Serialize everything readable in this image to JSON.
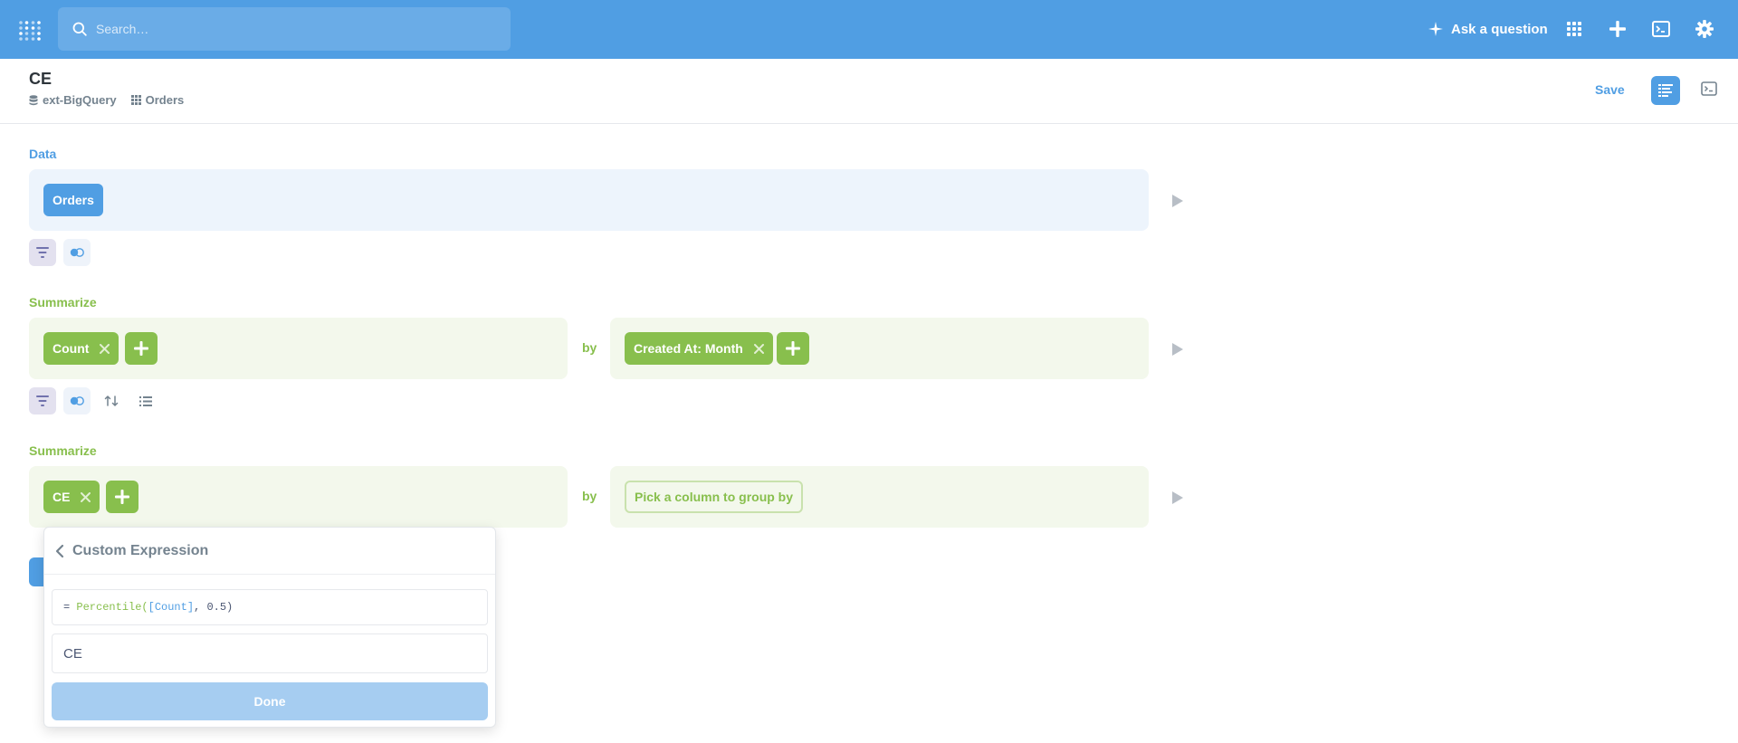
{
  "topbar": {
    "search_placeholder": "Search…",
    "ask_label": "Ask a question",
    "icons": [
      "metabase-logo-icon",
      "search-icon",
      "sparkle-icon",
      "grid-icon",
      "plus-icon",
      "sql-editor-icon",
      "gear-icon"
    ]
  },
  "header": {
    "title": "CE",
    "database": "ext-BigQuery",
    "table": "Orders",
    "save_label": "Save"
  },
  "notebook": {
    "data_step": {
      "label": "Data",
      "source": "Orders"
    },
    "summarize_1": {
      "label": "Summarize",
      "metric": "Count",
      "by_label": "by",
      "breakout": "Created At: Month"
    },
    "summarize_2": {
      "label": "Summarize",
      "metric": "CE",
      "by_label": "by",
      "pick_column": "Pick a column to group by"
    }
  },
  "popover": {
    "title": "Custom Expression",
    "expr_prefix": "= ",
    "expr_fn": "Percentile(",
    "expr_field": "[Count]",
    "expr_rest": ", 0.5)",
    "name_value": "CE",
    "done_label": "Done"
  },
  "colors": {
    "brand": "#509ee3",
    "summarize": "#88bf4d",
    "text_dark": "#2e353b",
    "text_medium": "#74838f"
  }
}
